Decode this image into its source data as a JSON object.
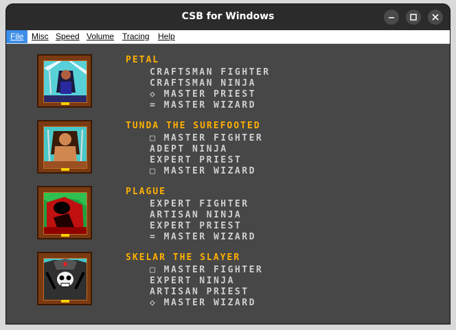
{
  "window": {
    "title": "CSB for Windows",
    "minimize_icon": "minimize-icon",
    "maximize_icon": "maximize-icon",
    "close_icon": "close-icon"
  },
  "menu": {
    "items": [
      {
        "label": "File",
        "active": true
      },
      {
        "label": "Misc",
        "active": false
      },
      {
        "label": "Speed",
        "active": false
      },
      {
        "label": "Volume",
        "active": false
      },
      {
        "label": "Tracing",
        "active": false
      },
      {
        "label": "Help",
        "active": false
      }
    ]
  },
  "champions": [
    {
      "name": "PETAL",
      "skills": [
        "CRAFTSMAN FIGHTER",
        "CRAFTSMAN NINJA",
        "◇ MASTER PRIEST",
        "= MASTER WIZARD"
      ]
    },
    {
      "name": "TUNDA THE SUREFOOTED",
      "skills": [
        "□ MASTER FIGHTER",
        "ADEPT NINJA",
        "EXPERT PRIEST",
        "□ MASTER WIZARD"
      ]
    },
    {
      "name": "PLAGUE",
      "skills": [
        "EXPERT FIGHTER",
        "ARTISAN NINJA",
        "EXPERT PRIEST",
        "= MASTER WIZARD"
      ]
    },
    {
      "name": "SKELAR THE SLAYER",
      "skills": [
        "□ MASTER FIGHTER",
        "EXPERT NINJA",
        "ARTISAN PRIEST",
        "◇ MASTER WIZARD"
      ]
    }
  ],
  "colors": {
    "name": "#ffb000",
    "skill": "#cfcfcf",
    "background": "#474747",
    "frame": "#7a3a12"
  }
}
